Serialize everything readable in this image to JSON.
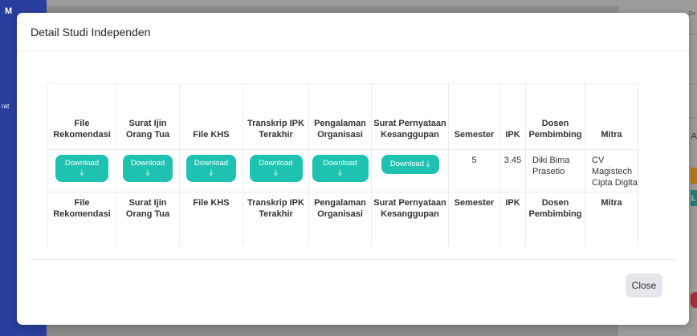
{
  "background": {
    "brand": "M",
    "nav_fragment": "rat",
    "right_top_text": "Dv",
    "right_letter": "A",
    "teal_chip_text": "L"
  },
  "modal": {
    "title": "Detail Studi Independen",
    "close_label": "Close"
  },
  "table": {
    "headers": [
      "File Rekomendasi",
      "Surat Ijin Orang Tua",
      "File KHS",
      "Transkrip IPK Terakhir",
      "Pengalaman Organisasi",
      "Surat Pernyataan Kesanggupan",
      "Semester",
      "IPK",
      "Dosen Pembimbing",
      "Mitra"
    ],
    "row": {
      "download_label": "Download",
      "download_icon": "download-icon",
      "semester": "5",
      "ipk": "3.45",
      "dosen": "Diki Bima Prasetio",
      "mitra": "CV Magistech Cipta Digita"
    }
  },
  "colors": {
    "accent": "#1fc2b1",
    "sidebar": "#2a3e9e",
    "close_button": "#e4e6eb"
  }
}
